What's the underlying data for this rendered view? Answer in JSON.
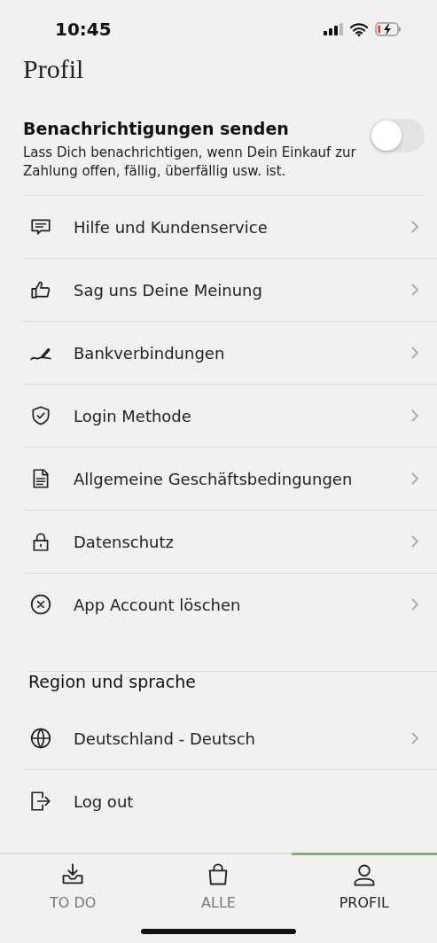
{
  "status_bar": {
    "time": "10:45"
  },
  "title": "Profil",
  "notifications": {
    "title": "Benachrichtigungen senden",
    "description": "Lass Dich benachrichtigen, wenn Dein Einkauf zur Zahlung offen, fällig, überfällig usw. ist.",
    "on": false
  },
  "menu_items": [
    {
      "label": "Hilfe und Kundenservice",
      "chevron": true
    },
    {
      "label": "Sag uns Deine Meinung",
      "chevron": true
    },
    {
      "label": "Bankverbindungen",
      "chevron": true
    },
    {
      "label": "Login Methode",
      "chevron": true
    },
    {
      "label": "Allgemeine Geschäftsbedingungen",
      "chevron": true
    },
    {
      "label": "Datenschutz",
      "chevron": true
    },
    {
      "label": "App Account löschen",
      "chevron": true
    }
  ],
  "region": {
    "heading": "Region und sprache",
    "items": [
      {
        "label": "Deutschland - Deutsch",
        "chevron": true
      },
      {
        "label": "Log out",
        "chevron": false
      }
    ]
  },
  "tabs": [
    {
      "label": "TO DO",
      "selected": false
    },
    {
      "label": "ALLE",
      "selected": false
    },
    {
      "label": "PROFIL",
      "selected": true
    }
  ]
}
